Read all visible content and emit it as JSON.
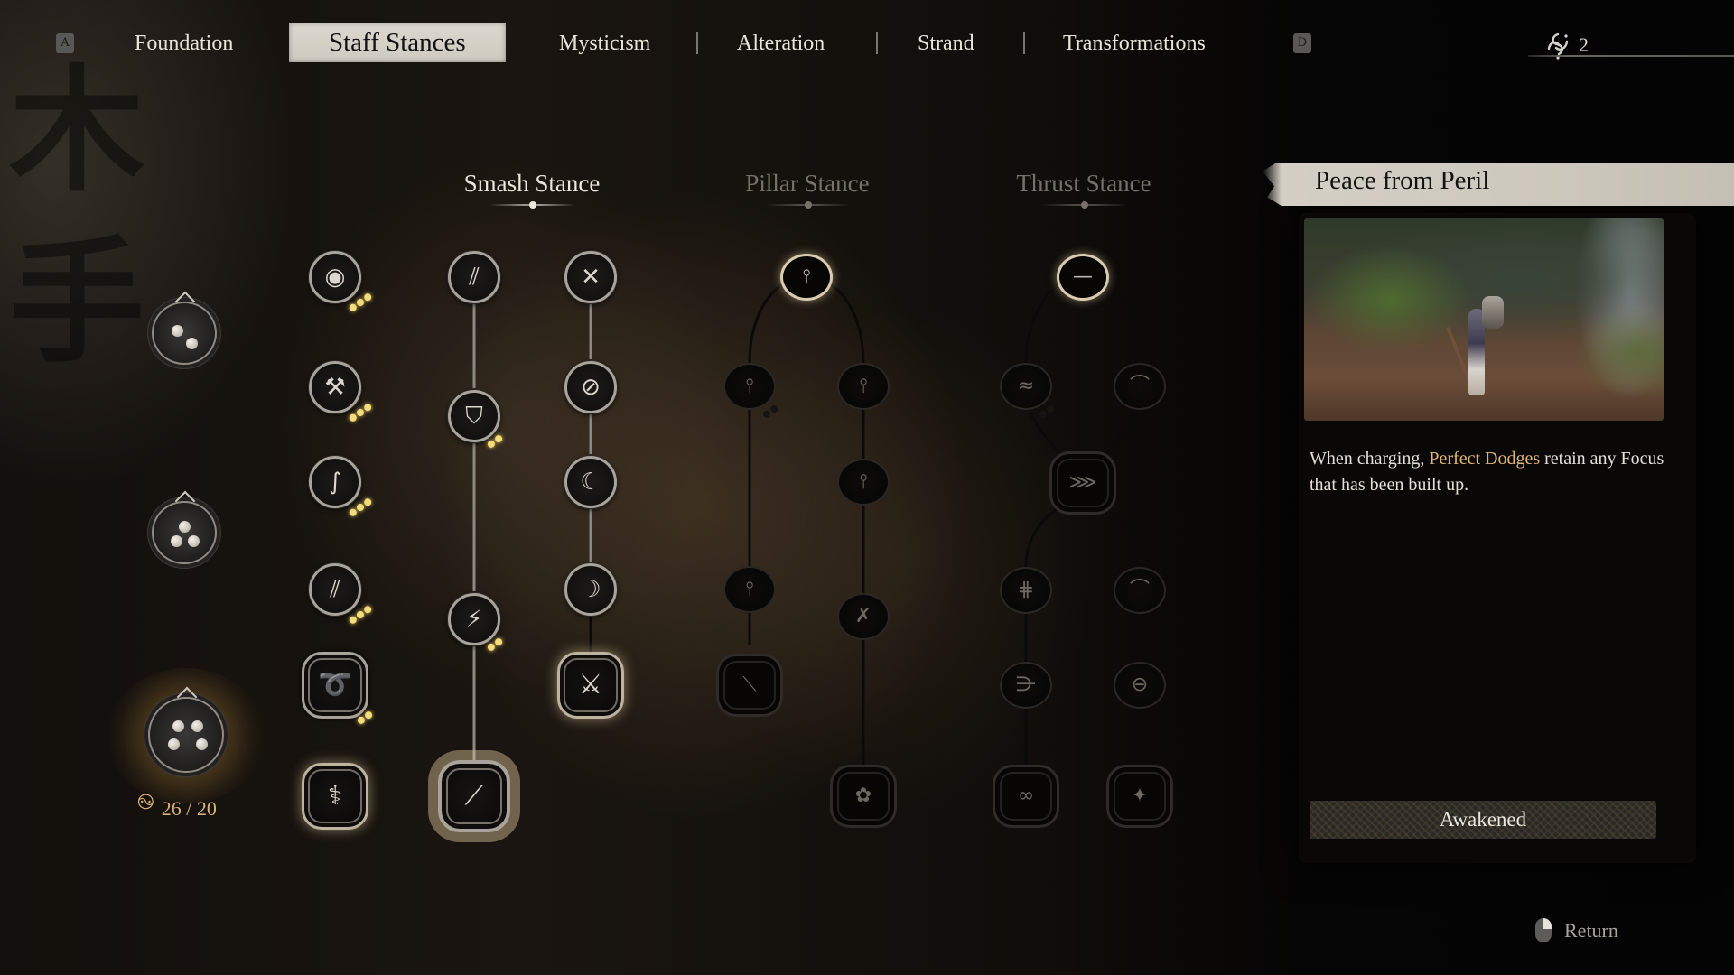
{
  "nav": {
    "left_key": "A",
    "right_key": "D",
    "tabs": [
      {
        "label": "Foundation",
        "active": false
      },
      {
        "label": "Staff Stances",
        "active": true
      },
      {
        "label": "Mysticism",
        "active": false
      },
      {
        "label": "Alteration",
        "active": false
      },
      {
        "label": "Strand",
        "active": false
      },
      {
        "label": "Transformations",
        "active": false
      }
    ],
    "currency": {
      "icon": "spark-icon",
      "value": "2"
    }
  },
  "stances": [
    {
      "label": "Smash Stance",
      "active": true
    },
    {
      "label": "Pillar Stance",
      "active": false
    },
    {
      "label": "Thrust Stance",
      "active": false
    }
  ],
  "focus_column": {
    "emblems": [
      {
        "name": "focus-level-2",
        "orbs": 2
      },
      {
        "name": "focus-level-3",
        "orbs": 3
      },
      {
        "name": "focus-level-4",
        "orbs": 4
      }
    ],
    "counter": {
      "icon": "spark-icon",
      "spent": "26",
      "total": "20",
      "text": "26 / 20"
    }
  },
  "tree": {
    "general_column": [
      {
        "icon": "focus-flame-icon",
        "state": "lit",
        "pips": 3
      },
      {
        "icon": "staff-grip-icon",
        "state": "lit",
        "pips": 3
      },
      {
        "icon": "staff-swing-icon",
        "state": "lit",
        "pips": 3
      },
      {
        "icon": "staff-rush-icon",
        "state": "lit",
        "pips": 3
      },
      {
        "icon": "coiled-staff-icon",
        "state": "big-lit",
        "pips": 2
      },
      {
        "icon": "spin-staff-icon",
        "state": "big-glow",
        "pips": 0
      }
    ],
    "smash_left": [
      {
        "icon": "smash-strike-icon",
        "state": "lit",
        "pips": 0
      },
      {
        "icon": "smash-guard-icon",
        "state": "lit",
        "pips": 2
      },
      {
        "icon": "smash-crack-icon",
        "state": "lit",
        "pips": 2
      },
      {
        "icon": "smash-focus-icon",
        "state": "big-selected",
        "pips": 0
      }
    ],
    "smash_right": [
      {
        "icon": "cross-staff-icon",
        "state": "lit",
        "pips": 0
      },
      {
        "icon": "slash-circle-icon",
        "state": "lit",
        "pips": 0
      },
      {
        "icon": "crescent-sweep-icon",
        "state": "lit",
        "pips": 0
      },
      {
        "icon": "crescent-focus-icon",
        "state": "lit",
        "pips": 0
      },
      {
        "icon": "cross-focus-icon",
        "state": "big-glow",
        "pips": 0
      }
    ],
    "pillar": [
      {
        "icon": "pillar-rise-icon",
        "state": "dim-start"
      },
      {
        "icon": "pillar-left-icon",
        "state": "dim",
        "pips": 2
      },
      {
        "icon": "pillar-spin-icon",
        "state": "dim"
      },
      {
        "icon": "pillar-whirl-icon",
        "state": "dim"
      },
      {
        "icon": "pillar-perch-icon",
        "state": "dim"
      },
      {
        "icon": "pillar-cross-icon",
        "state": "dim"
      },
      {
        "icon": "pillar-topple-icon",
        "state": "big-dim"
      },
      {
        "icon": "pillar-bloom-icon",
        "state": "big-dim"
      }
    ],
    "thrust": [
      {
        "icon": "thrust-line-icon",
        "state": "dim-start"
      },
      {
        "icon": "thrust-wave-icon",
        "state": "dim",
        "pips": 2
      },
      {
        "icon": "thrust-arc-icon",
        "state": "dim"
      },
      {
        "icon": "thrust-converge-icon",
        "state": "big-dim"
      },
      {
        "icon": "thrust-barrage-icon",
        "state": "dim"
      },
      {
        "icon": "thrust-arc2-icon",
        "state": "dim"
      },
      {
        "icon": "thrust-feather-icon",
        "state": "dim"
      },
      {
        "icon": "thrust-ring-icon",
        "state": "dim"
      },
      {
        "icon": "thrust-twin-icon",
        "state": "big-dim"
      },
      {
        "icon": "thrust-star-icon",
        "state": "big-dim"
      }
    ]
  },
  "detail": {
    "title": "Peace from Peril",
    "preview_icon": "gameplay-preview",
    "description_prefix": "When charging, ",
    "description_highlight": "Perfect Dodges",
    "description_suffix": " retain any Focus that has been built up.",
    "highlight_color": "#e2b672",
    "status": "Awakened"
  },
  "footer": {
    "return_label": "Return",
    "icon": "mouse-icon"
  }
}
